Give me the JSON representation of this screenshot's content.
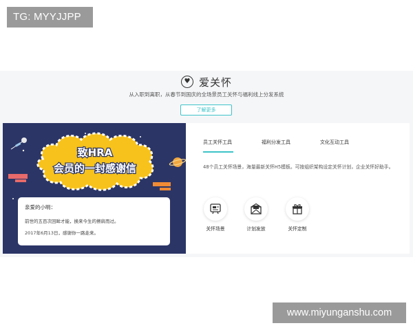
{
  "overlay": {
    "tg_text": "TG: MYYJJPP",
    "watermark_text": "www.miyunganshu.com"
  },
  "section": {
    "title": "爱关怀",
    "icon": "heart-icon",
    "subtitle": "从入职到离职，从春节到国庆的全场景员工关怀与福利线上分发系统",
    "learn_more": "了解更多"
  },
  "poster": {
    "headline_line1": "致HRA",
    "headline_line2": "会员的一封感谢信",
    "letter": {
      "greeting": "亲爱的小明：",
      "line1": "前世的五百次回眸才能，换来今生的擦肩而过。",
      "line2": "2017年6月13日，感谢你一路走来。"
    }
  },
  "tabs": [
    {
      "label": "员工关怀工具",
      "active": true
    },
    {
      "label": "福利分发工具",
      "active": false
    },
    {
      "label": "文化互动工具",
      "active": false
    }
  ],
  "description": "48个员工关怀场景，海量最新关怀H5模板。可按组织架构设定关怀计划，企业关怀好助手。",
  "features": [
    {
      "label": "关怀场景",
      "icon": "scene-icon"
    },
    {
      "label": "计划发放",
      "icon": "envelope-icon"
    },
    {
      "label": "关怀定制",
      "icon": "gift-icon"
    }
  ],
  "colors": {
    "accent": "#3cc3c8",
    "poster_bg": "#2b3566",
    "cloud": "#f7c21b",
    "banner_pink": "#e86a6a",
    "banner_orange": "#ef8b35"
  }
}
